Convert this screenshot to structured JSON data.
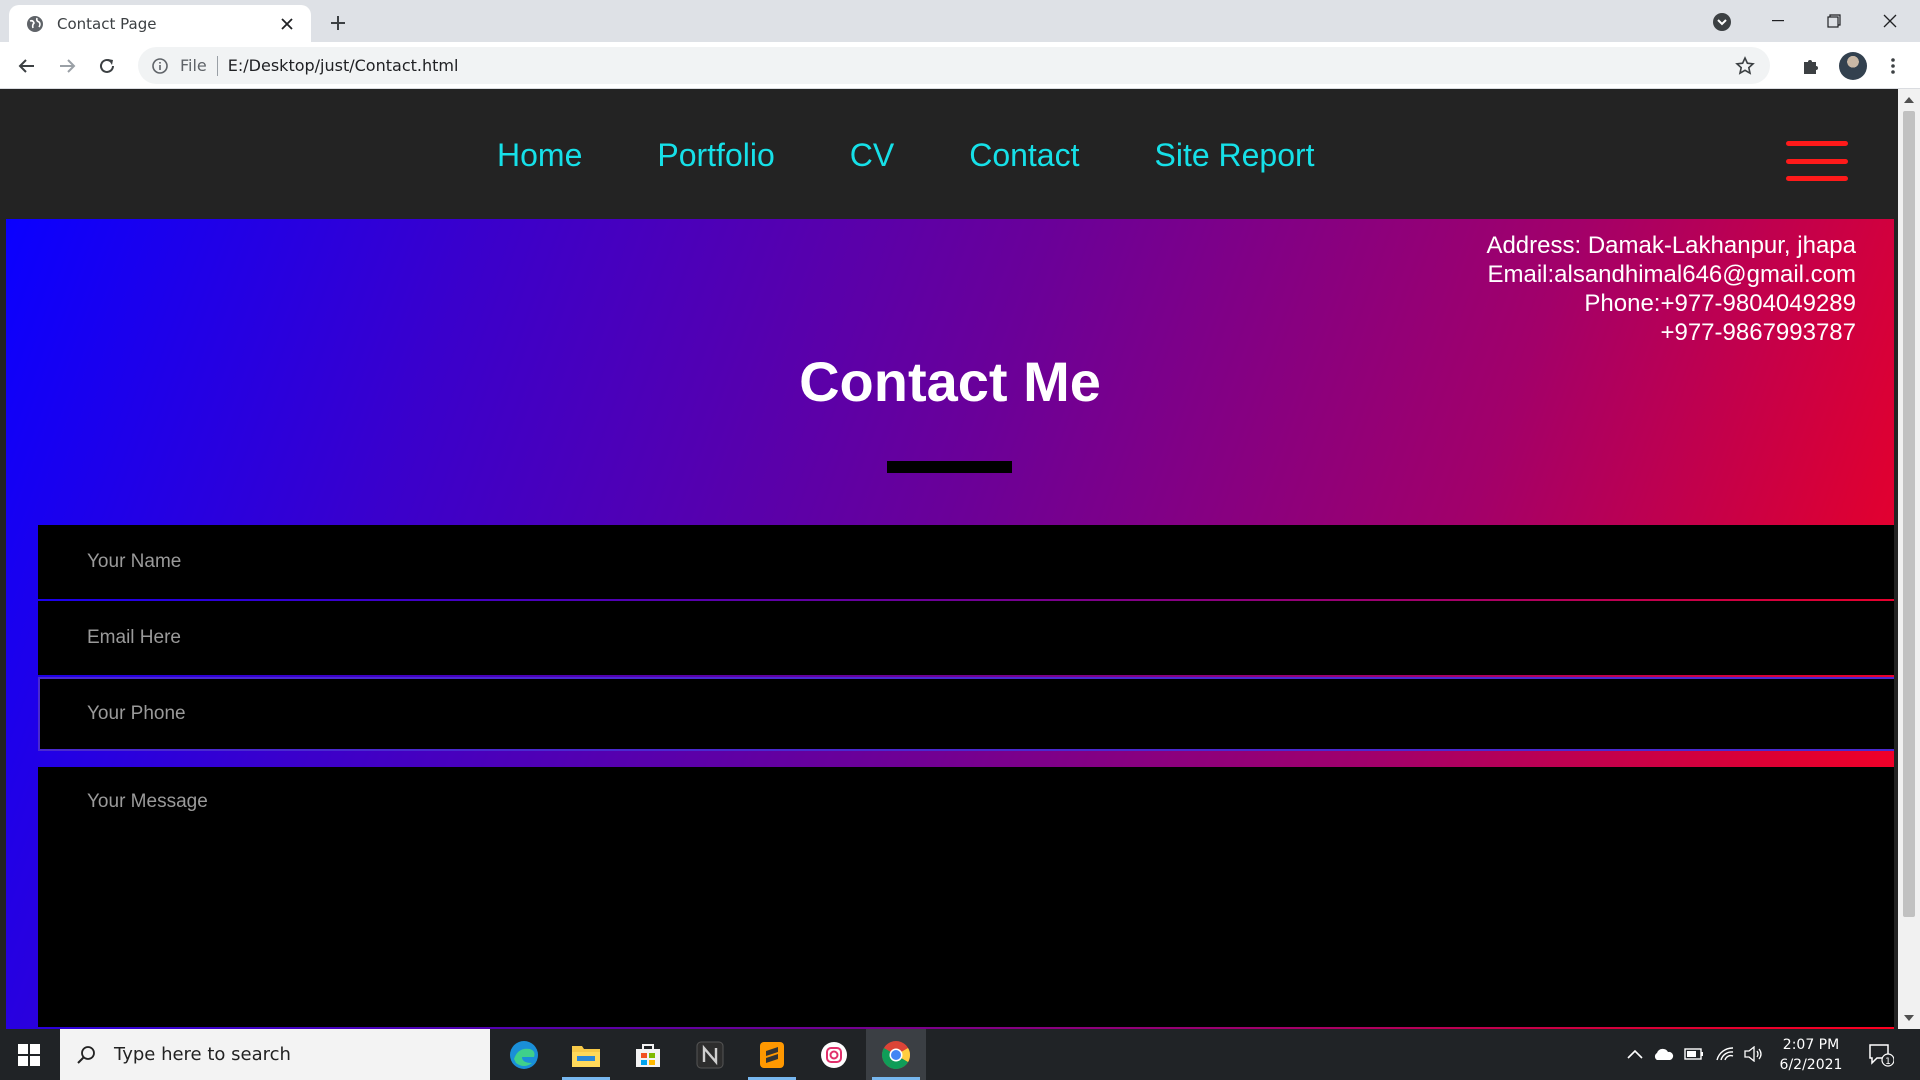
{
  "browser": {
    "tab_title": "Contact Page",
    "url_scheme": "File",
    "url": "E:/Desktop/just/Contact.html"
  },
  "site": {
    "nav": [
      "Home",
      "Portfolio",
      "CV",
      "Contact",
      "Site Report"
    ],
    "address": "Address: Damak-Lakhanpur, jhapa",
    "email": "Email:alsandhimal646@gmail.com",
    "phone1": "Phone:+977-9804049289",
    "phone2": "+977-9867993787",
    "heading": "Contact Me",
    "form": {
      "name_placeholder": "Your Name",
      "email_placeholder": "Email Here",
      "phone_placeholder": "Your Phone",
      "message_placeholder": "Your Message"
    },
    "colors": {
      "nav_link": "#16e0e8",
      "hamburger": "#ff1a1a",
      "gradient_start": "#0a00ff",
      "gradient_end": "#ff0020"
    }
  },
  "taskbar": {
    "search_placeholder": "Type here to search",
    "time": "2:07 PM",
    "date": "6/2/2021",
    "notification_count": "1",
    "apps": [
      "edge-icon",
      "file-explorer-icon",
      "store-icon",
      "notion-icon",
      "sublime-text-icon",
      "instagram-icon",
      "chrome-icon"
    ]
  }
}
